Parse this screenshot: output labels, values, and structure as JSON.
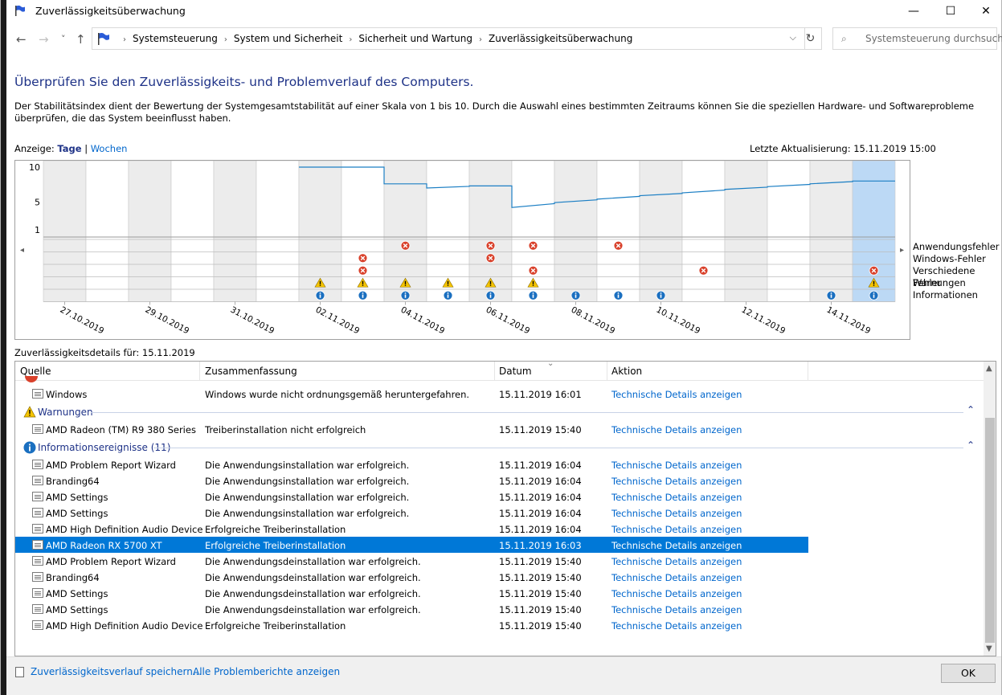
{
  "window": {
    "title": "Zuverlässigkeitsüberwachung",
    "minimize": "—",
    "maximize": "☐",
    "close": "✕"
  },
  "nav": {
    "back": "←",
    "forward": "→",
    "recent": "˅",
    "up": "↑",
    "breadcrumbs": [
      "Systemsteuerung",
      "System und Sicherheit",
      "Sicherheit und Wartung",
      "Zuverlässigkeitsüberwachung"
    ],
    "dropdown": "⌵",
    "refresh": "↻",
    "search_placeholder": "Systemsteuerung durchsuch..."
  },
  "heading": "Überprüfen Sie den Zuverlässigkeits- und Problemverlauf des Computers.",
  "description": "Der Stabilitätsindex dient der Bewertung der Systemgesamtstabilität auf einer Skala von 1 bis 10. Durch die Auswahl eines bestimmten Zeitraums können Sie die speziellen Hardware- und Softwareprobleme überprüfen, die das System beeinflusst haben.",
  "view": {
    "label": "Anzeige:",
    "days": "Tage",
    "separator": "|",
    "weeks": "Wochen"
  },
  "last_update": "Letzte Aktualisierung: 15.11.2019 15:00",
  "chart_data": {
    "type": "line",
    "yticks": [
      10,
      5,
      1
    ],
    "ylim": [
      1,
      10
    ],
    "days": [
      "27.10.2019",
      "28.10.2019",
      "29.10.2019",
      "30.10.2019",
      "31.10.2019",
      "01.11.2019",
      "02.11.2019",
      "03.11.2019",
      "04.11.2019",
      "05.11.2019",
      "06.11.2019",
      "07.11.2019",
      "08.11.2019",
      "09.11.2019",
      "10.11.2019",
      "11.11.2019",
      "12.11.2019",
      "13.11.2019",
      "14.11.2019",
      "15.11.2019"
    ],
    "date_labels": [
      "27.10.2019",
      "29.10.2019",
      "31.10.2019",
      "02.11.2019",
      "04.11.2019",
      "06.11.2019",
      "08.11.2019",
      "10.11.2019",
      "12.11.2019",
      "14.11.2019"
    ],
    "selected_day": "15.11.2019",
    "stability_index": [
      null,
      null,
      null,
      null,
      null,
      null,
      10,
      10,
      7.6,
      7,
      7.3,
      4.2,
      4.9,
      5.4,
      5.9,
      6.3,
      6.8,
      7.2,
      7.6,
      8
    ],
    "categories": [
      "Anwendungsfehler",
      "Windows-Fehler",
      "Verschiedene Fehler",
      "Warnungen",
      "Informationen"
    ],
    "events": {
      "Anwendungsfehler": [
        "04.11.2019",
        "06.11.2019",
        "07.11.2019",
        "09.11.2019"
      ],
      "Windows-Fehler": [
        "03.11.2019",
        "06.11.2019"
      ],
      "Verschiedene Fehler": [
        "03.11.2019",
        "07.11.2019",
        "11.11.2019",
        "15.11.2019"
      ],
      "Warnungen": [
        "02.11.2019",
        "03.11.2019",
        "04.11.2019",
        "05.11.2019",
        "06.11.2019",
        "07.11.2019",
        "15.11.2019"
      ],
      "Informationen": [
        "02.11.2019",
        "03.11.2019",
        "04.11.2019",
        "05.11.2019",
        "06.11.2019",
        "07.11.2019",
        "08.11.2019",
        "09.11.2019",
        "10.11.2019",
        "14.11.2019",
        "15.11.2019"
      ]
    },
    "scroll_left": "◂",
    "scroll_right": "▸"
  },
  "details_label": "Zuverlässigkeitsdetails für: 15.11.2019",
  "table": {
    "columns": [
      "Quelle",
      "Zusammenfassung",
      "Datum",
      "Aktion"
    ],
    "sort_glyph": "⌄",
    "top_row": {
      "source": "Windows",
      "summary": "Windows wurde nicht ordnungsgemäß heruntergefahren.",
      "date": "15.11.2019 16:01",
      "action": "Technische Details anzeigen"
    },
    "warnings_group": {
      "label": "Warnungen",
      "chevron": "⌃"
    },
    "warning_rows": [
      {
        "source": "AMD Radeon (TM) R9 380 Series",
        "summary": "Treiberinstallation nicht erfolgreich",
        "date": "15.11.2019 15:40",
        "action": "Technische Details anzeigen"
      }
    ],
    "info_group": {
      "label": "Informationsereignisse (11)",
      "chevron": "⌃"
    },
    "info_rows": [
      {
        "source": "AMD Problem Report Wizard",
        "summary": "Die Anwendungsinstallation war erfolgreich.",
        "date": "15.11.2019 16:04",
        "action": "Technische Details anzeigen"
      },
      {
        "source": "Branding64",
        "summary": "Die Anwendungsinstallation war erfolgreich.",
        "date": "15.11.2019 16:04",
        "action": "Technische Details anzeigen"
      },
      {
        "source": "AMD Settings",
        "summary": "Die Anwendungsinstallation war erfolgreich.",
        "date": "15.11.2019 16:04",
        "action": "Technische Details anzeigen"
      },
      {
        "source": "AMD Settings",
        "summary": "Die Anwendungsinstallation war erfolgreich.",
        "date": "15.11.2019 16:04",
        "action": "Technische Details anzeigen"
      },
      {
        "source": "AMD High Definition Audio Device",
        "summary": "Erfolgreiche Treiberinstallation",
        "date": "15.11.2019 16:04",
        "action": "Technische Details anzeigen"
      },
      {
        "source": "AMD Radeon RX 5700 XT",
        "summary": "Erfolgreiche Treiberinstallation",
        "date": "15.11.2019 16:03",
        "action": "Technische Details anzeigen",
        "selected": true
      },
      {
        "source": "AMD Problem Report Wizard",
        "summary": "Die Anwendungsdeinstallation war erfolgreich.",
        "date": "15.11.2019 15:40",
        "action": "Technische Details anzeigen"
      },
      {
        "source": "Branding64",
        "summary": "Die Anwendungsdeinstallation war erfolgreich.",
        "date": "15.11.2019 15:40",
        "action": "Technische Details anzeigen"
      },
      {
        "source": "AMD Settings",
        "summary": "Die Anwendungsdeinstallation war erfolgreich.",
        "date": "15.11.2019 15:40",
        "action": "Technische Details anzeigen"
      },
      {
        "source": "AMD Settings",
        "summary": "Die Anwendungsdeinstallation war erfolgreich.",
        "date": "15.11.2019 15:40",
        "action": "Technische Details anzeigen"
      },
      {
        "source": "AMD High Definition Audio Device",
        "summary": "Erfolgreiche Treiberinstallation",
        "date": "15.11.2019 15:40",
        "action": "Technische Details anzeigen"
      }
    ],
    "scroll_up": "▲",
    "scroll_down": "▼"
  },
  "footer": {
    "save_link": "Zuverlässigkeitsverlauf speichern...",
    "reports_link": "Alle Problemberichte anzeigen",
    "ok": "OK"
  },
  "colors": {
    "heading": "#1e3287",
    "link": "#0066cc",
    "selection": "#0078d7",
    "line": "#1c7fc4",
    "error": "#d9412b",
    "warning": "#f5c400",
    "info": "#1a6fc0",
    "column_shade": "#ececec",
    "selected_column": "#bcd9f5"
  }
}
